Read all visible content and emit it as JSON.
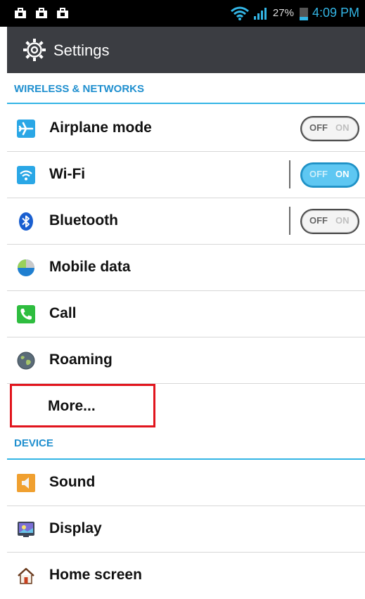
{
  "status_bar": {
    "notification_icons": [
      "bag-icon",
      "bag-icon",
      "bag-icon"
    ],
    "battery_percent": "27%",
    "time": "4:09 PM"
  },
  "action_bar": {
    "title": "Settings",
    "icon": "gear-icon"
  },
  "sections": {
    "wireless": {
      "title": "WIRELESS & NETWORKS",
      "items": [
        {
          "label": "Airplane mode",
          "icon": "airplane-icon",
          "toggle": {
            "off": "OFF",
            "on": "ON",
            "state": "off"
          }
        },
        {
          "label": "Wi-Fi",
          "icon": "wifi-icon",
          "toggle": {
            "off": "OFF",
            "on": "ON",
            "state": "on"
          }
        },
        {
          "label": "Bluetooth",
          "icon": "bluetooth-icon",
          "toggle": {
            "off": "OFF",
            "on": "ON",
            "state": "off"
          }
        },
        {
          "label": "Mobile data",
          "icon": "mobile-data-icon"
        },
        {
          "label": "Call",
          "icon": "phone-icon"
        },
        {
          "label": "Roaming",
          "icon": "globe-icon"
        },
        {
          "label": "More..."
        }
      ]
    },
    "device": {
      "title": "DEVICE",
      "items": [
        {
          "label": "Sound",
          "icon": "speaker-icon"
        },
        {
          "label": "Display",
          "icon": "display-icon"
        },
        {
          "label": "Home screen",
          "icon": "home-icon"
        }
      ]
    }
  },
  "colors": {
    "accent": "#33b5e5",
    "highlight": "#e1151d",
    "action_bar": "#3b3d42"
  }
}
